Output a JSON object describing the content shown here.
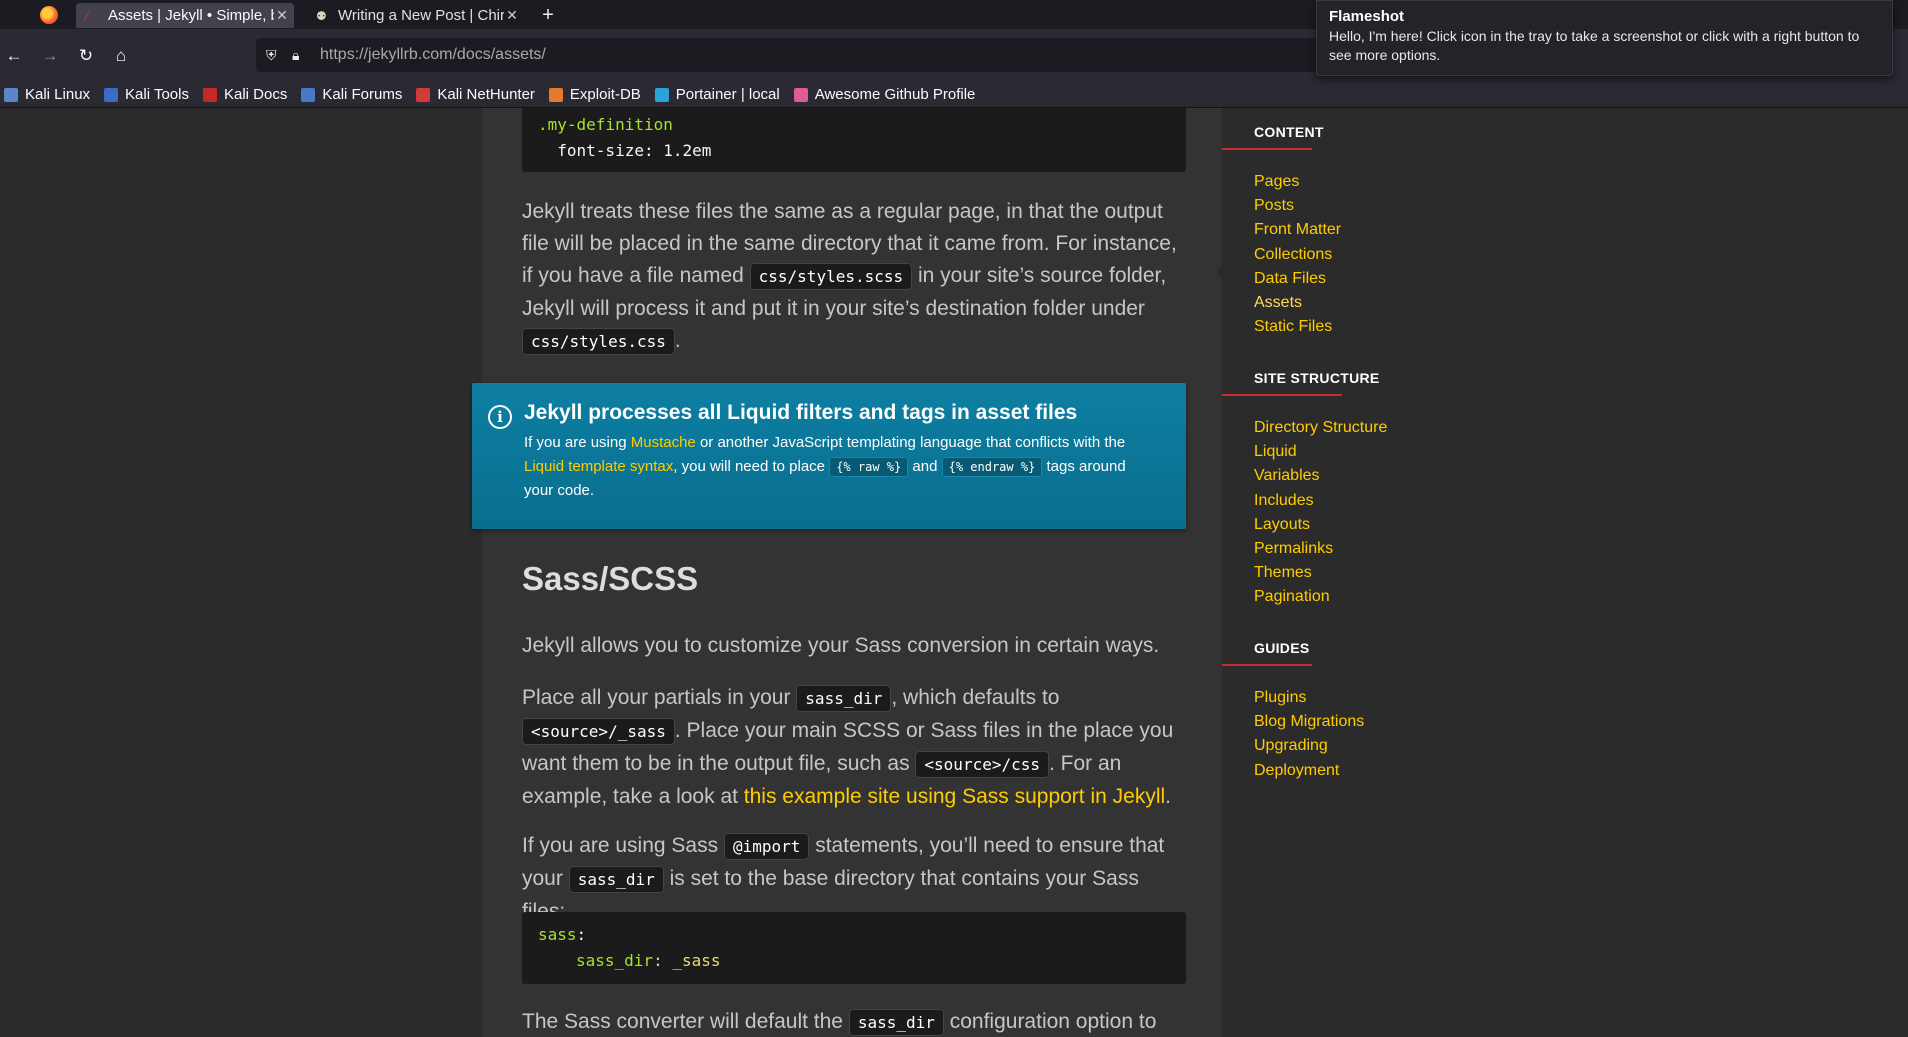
{
  "browser": {
    "tabs": [
      {
        "label": "Assets | Jekyll • Simple, bl",
        "active": true,
        "favicon": "jekyll-test-tube-icon"
      },
      {
        "label": "Writing a New Post | Chir",
        "active": false,
        "favicon": "chirpy-icon"
      }
    ],
    "new_tab_label": "+",
    "url_host": "https://jekyllrb.com",
    "url_path": "/docs/assets/",
    "bookmarks": [
      {
        "label": "Kali Linux",
        "color": "#5b87c9"
      },
      {
        "label": "Kali Tools",
        "color": "#3b6bc4"
      },
      {
        "label": "Kali Docs",
        "color": "#c62828"
      },
      {
        "label": "Kali Forums",
        "color": "#4a78c9"
      },
      {
        "label": "Kali NetHunter",
        "color": "#d23b3b"
      },
      {
        "label": "Exploit-DB",
        "color": "#e57b2a"
      },
      {
        "label": "Portainer | local",
        "color": "#2aa3d8"
      },
      {
        "label": "Awesome Github Profile",
        "color": "#e05a96"
      }
    ]
  },
  "notification": {
    "title": "Flameshot",
    "body": "Hello, I'm here! Click icon in the tray to take a screenshot or click with a right button to see more options."
  },
  "content": {
    "code1_line1": ".my-definition",
    "code1_line2": "  font-size: 1.2em",
    "para1_a": "Jekyll treats these files the same as a regular page, in that the output file will be placed in the same directory that it came from. For instance, if you have a file named ",
    "para1_code1": "css/styles.scss",
    "para1_b": " in your site’s source folder, Jekyll will process it and put it in your site’s destination folder under ",
    "para1_code2": "css/styles.css",
    "para1_c": ".",
    "callout_title": "Jekyll processes all Liquid filters and tags in asset files",
    "callout_a": "If you are using ",
    "callout_link1": "Mustache",
    "callout_b": " or another JavaScript templating language that conflicts with the ",
    "callout_link2": "Liquid template syntax",
    "callout_c": ", you will need to place ",
    "callout_code1": "{% raw %}",
    "callout_d": " and ",
    "callout_code2": "{% endraw %}",
    "callout_e": " tags around your code.",
    "heading": "Sass/SCSS",
    "para2": "Jekyll allows you to customize your Sass conversion in certain ways.",
    "para3_a": "Place all your partials in your ",
    "para3_code1": "sass_dir",
    "para3_b": ", which defaults to ",
    "para3_code2": "<source>/_sass",
    "para3_c": ". Place your main SCSS or Sass files in the place you want them to be in the output file, such as ",
    "para3_code3": "<source>/css",
    "para3_d": ". For an example, take a look at ",
    "para3_link": "this example site using Sass support in Jekyll",
    "para3_e": ".",
    "para4_a": "If you are using Sass ",
    "para4_code1": "@import",
    "para4_b": " statements, you’ll need to ensure that your ",
    "para4_code2": "sass_dir",
    "para4_c": " is set to the base directory that contains your Sass files:",
    "code2_key": "sass",
    "code2_colon": ":",
    "code2_subkey": "sass_dir",
    "code2_val": ": _sass",
    "para5_a": "The Sass converter will default the ",
    "para5_code": "sass_dir",
    "para5_b": " configuration option to"
  },
  "sidebar": {
    "sections": [
      {
        "title": "CONTENT",
        "items": [
          "Pages",
          "Posts",
          "Front Matter",
          "Collections",
          "Data Files",
          "Assets",
          "Static Files"
        ]
      },
      {
        "title": "SITE STRUCTURE",
        "items": [
          "Directory Structure",
          "Liquid",
          "Variables",
          "Includes",
          "Layouts",
          "Permalinks",
          "Themes",
          "Pagination"
        ]
      },
      {
        "title": "GUIDES",
        "items": [
          "Plugins",
          "Blog Migrations",
          "Upgrading",
          "Deployment"
        ]
      }
    ],
    "current": "Assets",
    "accent_color": "#c32e2e",
    "link_color": "#ffcc00"
  }
}
